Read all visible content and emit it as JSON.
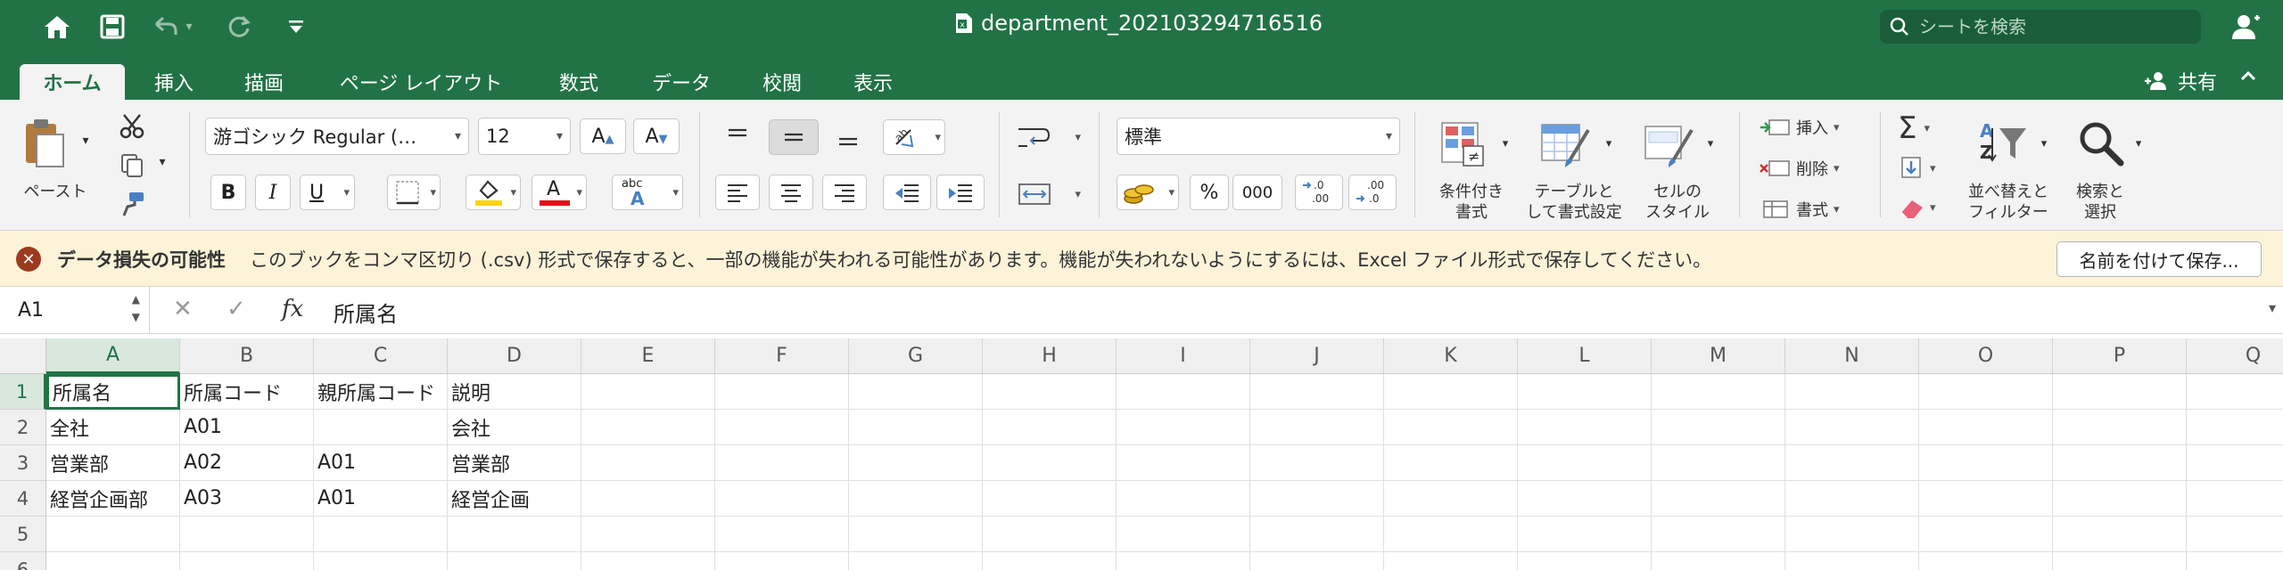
{
  "window": {
    "title": "department_202103294716516",
    "search_placeholder": "シートを検索"
  },
  "tabs": [
    "ホーム",
    "挿入",
    "描画",
    "ページ レイアウト",
    "数式",
    "データ",
    "校閲",
    "表示"
  ],
  "share_label": "共有",
  "ribbon": {
    "paste_label": "ペースト",
    "font_name": "游ゴシック Regular (…",
    "font_size": "12",
    "number_format": "標準",
    "insert_label": "挿入",
    "delete_label": "削除",
    "format_label": "書式",
    "bold": "B",
    "italic": "I",
    "underline": "U",
    "font_color_letter": "A",
    "abc_label": "abc",
    "percent": "%",
    "thousands": "000",
    "cond_format_l1": "条件付き",
    "cond_format_l2": "書式",
    "table_format_l1": "テーブルと",
    "table_format_l2": "して書式設定",
    "cell_style_l1": "セルの",
    "cell_style_l2": "スタイル",
    "sort_l1": "並べ替えと",
    "sort_l2": "フィルター",
    "find_l1": "検索と",
    "find_l2": "選択"
  },
  "message_bar": {
    "title": "データ損失の可能性",
    "text": "このブックをコンマ区切り (.csv) 形式で保存すると、一部の機能が失われる可能性があります。機能が失われないようにするには、Excel ファイル形式で保存してください。",
    "button": "名前を付けて保存..."
  },
  "formula_bar": {
    "cell_ref": "A1",
    "fx": "fx",
    "content": "所属名"
  },
  "colors": {
    "accent": "#217346",
    "warning_bg": "#fcf3d9",
    "error_icon": "#9c3a1e"
  },
  "sheet": {
    "columns": [
      "A",
      "B",
      "C",
      "D",
      "E",
      "F",
      "G",
      "H",
      "I",
      "J",
      "K",
      "L",
      "M",
      "N",
      "O",
      "P",
      "Q"
    ],
    "rows": [
      "1",
      "2",
      "3",
      "4",
      "5",
      "6"
    ],
    "cells": [
      [
        "所属名",
        "所属コード",
        "親所属コード",
        "説明"
      ],
      [
        "全社",
        "A01",
        "",
        "会社"
      ],
      [
        "営業部",
        "A02",
        "A01",
        "営業部"
      ],
      [
        "経営企画部",
        "A03",
        "A01",
        "経営企画"
      ],
      [
        "",
        "",
        "",
        ""
      ],
      [
        "",
        "",
        "",
        ""
      ]
    ]
  }
}
